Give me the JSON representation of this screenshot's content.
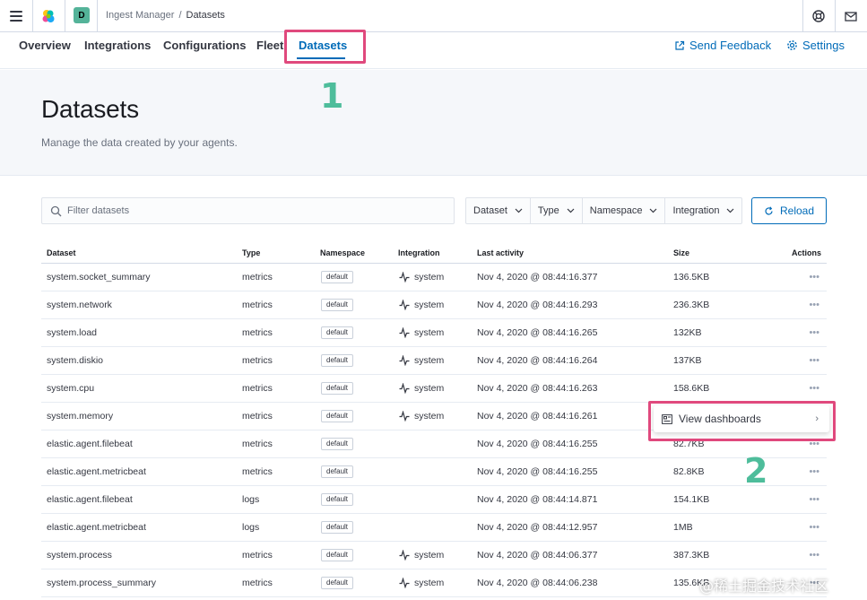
{
  "header": {
    "space_initial": "D",
    "breadcrumb": [
      "Ingest Manager",
      "Datasets"
    ],
    "breadcrumb_sep": "/"
  },
  "nav": {
    "tabs": [
      {
        "label": "Overview",
        "active": false
      },
      {
        "label": "Integrations",
        "active": false
      },
      {
        "label": "Configurations",
        "active": false
      },
      {
        "label": "Fleet",
        "active": false
      },
      {
        "label": "Datasets",
        "active": true
      }
    ],
    "send_feedback": "Send Feedback",
    "settings": "Settings"
  },
  "page": {
    "title": "Datasets",
    "description": "Manage the data created by your agents."
  },
  "annotations": {
    "marker_1": "1",
    "marker_2": "2",
    "color": "#e0497d",
    "number_color": "#4ebd9b"
  },
  "filters": {
    "search_placeholder": "Filter datasets",
    "dropdowns": [
      "Dataset",
      "Type",
      "Namespace",
      "Integration"
    ],
    "reload_label": "Reload"
  },
  "table": {
    "columns": [
      "Dataset",
      "Type",
      "Namespace",
      "Integration",
      "Last activity",
      "Size",
      "Actions"
    ],
    "rows": [
      {
        "dataset": "system.socket_summary",
        "type": "metrics",
        "namespace": "default",
        "integration": "system",
        "last_activity": "Nov 4, 2020 @ 08:44:16.377",
        "size": "136.5KB"
      },
      {
        "dataset": "system.network",
        "type": "metrics",
        "namespace": "default",
        "integration": "system",
        "last_activity": "Nov 4, 2020 @ 08:44:16.293",
        "size": "236.3KB"
      },
      {
        "dataset": "system.load",
        "type": "metrics",
        "namespace": "default",
        "integration": "system",
        "last_activity": "Nov 4, 2020 @ 08:44:16.265",
        "size": "132KB"
      },
      {
        "dataset": "system.diskio",
        "type": "metrics",
        "namespace": "default",
        "integration": "system",
        "last_activity": "Nov 4, 2020 @ 08:44:16.264",
        "size": "137KB"
      },
      {
        "dataset": "system.cpu",
        "type": "metrics",
        "namespace": "default",
        "integration": "system",
        "last_activity": "Nov 4, 2020 @ 08:44:16.263",
        "size": "158.6KB"
      },
      {
        "dataset": "system.memory",
        "type": "metrics",
        "namespace": "default",
        "integration": "system",
        "last_activity": "Nov 4, 2020 @ 08:44:16.261",
        "size": ""
      },
      {
        "dataset": "elastic.agent.filebeat",
        "type": "metrics",
        "namespace": "default",
        "integration": "",
        "last_activity": "Nov 4, 2020 @ 08:44:16.255",
        "size": "82.7KB"
      },
      {
        "dataset": "elastic.agent.metricbeat",
        "type": "metrics",
        "namespace": "default",
        "integration": "",
        "last_activity": "Nov 4, 2020 @ 08:44:16.255",
        "size": "82.8KB"
      },
      {
        "dataset": "elastic.agent.filebeat",
        "type": "logs",
        "namespace": "default",
        "integration": "",
        "last_activity": "Nov 4, 2020 @ 08:44:14.871",
        "size": "154.1KB"
      },
      {
        "dataset": "elastic.agent.metricbeat",
        "type": "logs",
        "namespace": "default",
        "integration": "",
        "last_activity": "Nov 4, 2020 @ 08:44:12.957",
        "size": "1MB"
      },
      {
        "dataset": "system.process",
        "type": "metrics",
        "namespace": "default",
        "integration": "system",
        "last_activity": "Nov 4, 2020 @ 08:44:06.377",
        "size": "387.3KB"
      },
      {
        "dataset": "system.process_summary",
        "type": "metrics",
        "namespace": "default",
        "integration": "system",
        "last_activity": "Nov 4, 2020 @ 08:44:06.238",
        "size": "135.6KB"
      }
    ],
    "actions_glyph": "•••"
  },
  "popover": {
    "item_label": "View dashboards"
  },
  "watermark": "@稀土掘金技术社区",
  "colors": {
    "accent": "#006bb8",
    "page_bg": "#f5f7fa"
  }
}
